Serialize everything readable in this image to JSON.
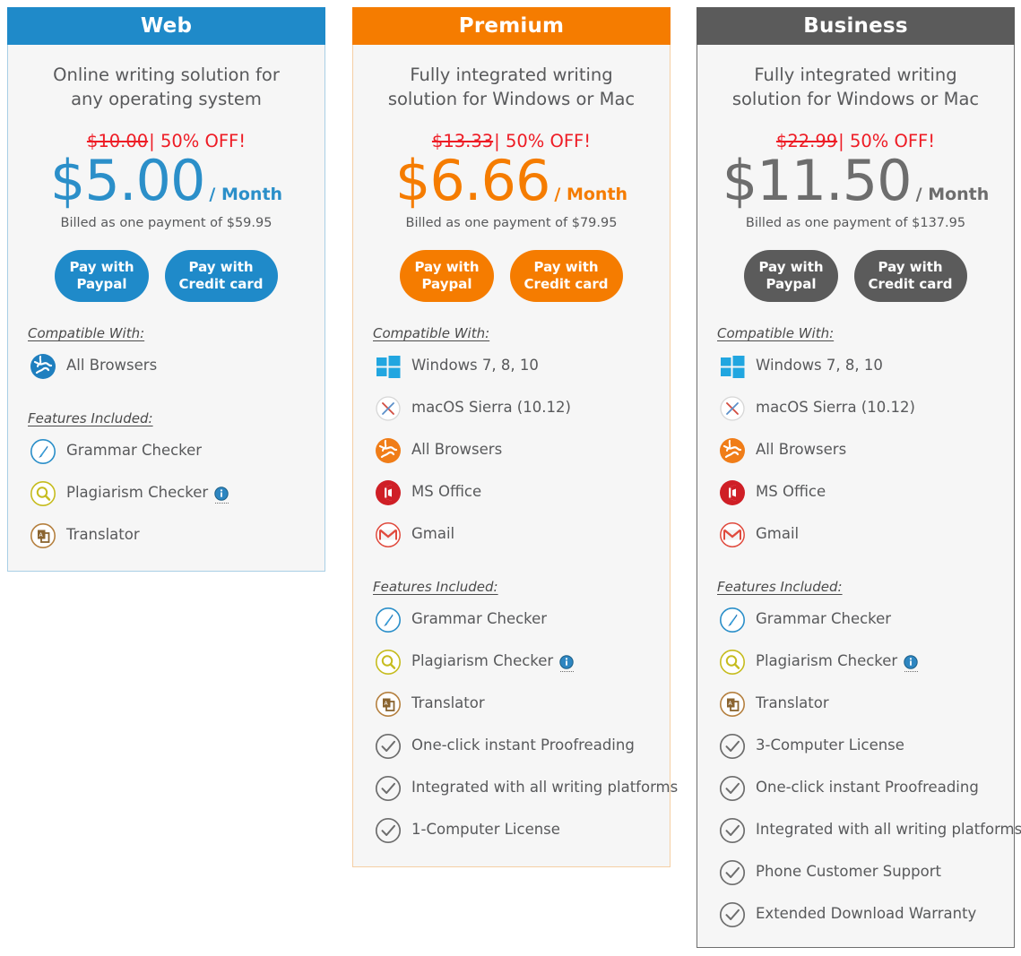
{
  "plans": [
    {
      "id": "web",
      "name": "Web",
      "accent": "#1f8ac9",
      "border": "#a9cfe5",
      "tagline_line1": "Online writing solution for",
      "tagline_line2": "any operating system",
      "old_price": "$10.00",
      "separator": "|",
      "discount": "50% OFF!",
      "price": "$5.00",
      "period": "/ Month",
      "billed": "Billed as one payment of $59.95",
      "buttons": [
        {
          "line1": "Pay with",
          "line2": "Paypal"
        },
        {
          "line1": "Pay with",
          "line2": "Credit card"
        }
      ],
      "compatible_title": "Compatible With:",
      "compatible": [
        {
          "icon": "globe-blue-icon",
          "label": "All Browsers"
        }
      ],
      "features_title": "Features Included:",
      "features": [
        {
          "icon": "compass-pen-icon",
          "label": "Grammar Checker",
          "info": false
        },
        {
          "icon": "magnifier-icon",
          "label": "Plagiarism Checker",
          "info": true
        },
        {
          "icon": "translator-icon",
          "label": "Translator",
          "info": false
        }
      ]
    },
    {
      "id": "premium",
      "name": "Premium",
      "accent": "#f57c00",
      "border": "#f5cfa4",
      "tagline_line1": "Fully integrated writing",
      "tagline_line2": "solution for Windows or Mac",
      "old_price": "$13.33",
      "separator": "|",
      "discount": "50% OFF!",
      "price": "$6.66",
      "period": "/ Month",
      "billed": "Billed as one payment of $79.95",
      "buttons": [
        {
          "line1": "Pay with",
          "line2": "Paypal"
        },
        {
          "line1": "Pay with",
          "line2": "Credit card"
        }
      ],
      "compatible_title": "Compatible With:",
      "compatible": [
        {
          "icon": "windows-icon",
          "label": "Windows 7, 8, 10"
        },
        {
          "icon": "macos-icon",
          "label": "macOS Sierra (10.12)"
        },
        {
          "icon": "globe-orange-icon",
          "label": "All Browsers"
        },
        {
          "icon": "ms-office-icon",
          "label": "MS Office"
        },
        {
          "icon": "gmail-icon",
          "label": "Gmail"
        }
      ],
      "features_title": "Features Included:",
      "features": [
        {
          "icon": "compass-pen-icon",
          "label": "Grammar Checker",
          "info": false
        },
        {
          "icon": "magnifier-icon",
          "label": "Plagiarism Checker",
          "info": true
        },
        {
          "icon": "translator-icon",
          "label": "Translator",
          "info": false
        },
        {
          "icon": "check-circle-icon",
          "label": "One-click instant Proofreading",
          "info": false
        },
        {
          "icon": "check-circle-icon",
          "label": "Integrated with all writing platforms",
          "info": false
        },
        {
          "icon": "check-circle-icon",
          "label": "1-Computer License",
          "info": false
        }
      ]
    },
    {
      "id": "business",
      "name": "Business",
      "accent": "#5b5b5b",
      "border": "#6e6e6e",
      "tagline_line1": "Fully integrated writing",
      "tagline_line2": "solution for Windows or Mac",
      "old_price": "$22.99",
      "separator": "|",
      "discount": "50% OFF!",
      "price": "$11.50",
      "period": "/ Month",
      "billed": "Billed as one payment of $137.95",
      "buttons": [
        {
          "line1": "Pay with",
          "line2": "Paypal"
        },
        {
          "line1": "Pay with",
          "line2": "Credit card"
        }
      ],
      "compatible_title": "Compatible With:",
      "compatible": [
        {
          "icon": "windows-icon",
          "label": "Windows 7, 8, 10"
        },
        {
          "icon": "macos-icon",
          "label": "macOS Sierra (10.12)"
        },
        {
          "icon": "globe-orange-icon",
          "label": "All Browsers"
        },
        {
          "icon": "ms-office-icon",
          "label": "MS Office"
        },
        {
          "icon": "gmail-icon",
          "label": "Gmail"
        }
      ],
      "features_title": "Features Included:",
      "features": [
        {
          "icon": "compass-pen-icon",
          "label": "Grammar Checker",
          "info": false
        },
        {
          "icon": "magnifier-icon",
          "label": "Plagiarism Checker",
          "info": true
        },
        {
          "icon": "translator-icon",
          "label": "Translator",
          "info": false
        },
        {
          "icon": "check-circle-icon",
          "label": "3-Computer License",
          "info": false
        },
        {
          "icon": "check-circle-icon",
          "label": "One-click instant Proofreading",
          "info": false
        },
        {
          "icon": "check-circle-icon",
          "label": "Integrated with all writing platforms",
          "info": false
        },
        {
          "icon": "check-circle-icon",
          "label": "Phone Customer Support",
          "info": false
        },
        {
          "icon": "check-circle-icon",
          "label": "Extended Download Warranty",
          "info": false
        }
      ]
    }
  ]
}
